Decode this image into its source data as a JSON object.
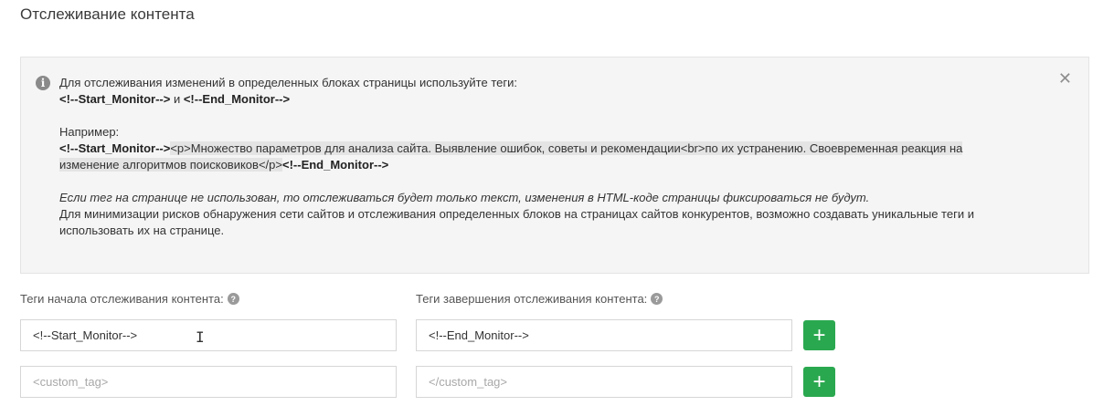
{
  "page": {
    "title": "Отслеживание контента"
  },
  "info": {
    "line1": "Для отслеживания изменений в определенных блоках страницы используйте теги:",
    "start_tag": "<!--Start_Monitor-->",
    "and_word": " и ",
    "end_tag": "<!--End_Monitor-->",
    "example_label": "Например:",
    "example_start_tag": "<!--Start_Monitor-->",
    "example_code": "<p>Множество параметров для анализа сайта. Выявление ошибок, советы и рекомендации<br>по их устранению. Своевременная реакция на изменение алгоритмов поисковиков</p>",
    "example_end_tag": "<!--End_Monitor-->",
    "note_italic": "Если тег на странице не использован, то отслеживаться будет только текст, изменения в HTML-коде страницы фиксироваться не будут.",
    "note_plain": "Для минимизации рисков обнаружения сети сайтов и отслеживания определенных блоков на страницах сайтов конкурентов, возможно создавать уникальные теги и использовать их на странице."
  },
  "form": {
    "start_label": "Теги начала отслеживания контента:",
    "end_label": "Теги завершения отслеживания контента:",
    "help_glyph": "?",
    "add_glyph": "+",
    "rows": [
      {
        "start_value": "<!--Start_Monitor-->",
        "start_placeholder": "",
        "end_value": "<!--End_Monitor-->",
        "end_placeholder": ""
      },
      {
        "start_value": "",
        "start_placeholder": "<custom_tag>",
        "end_value": "",
        "end_placeholder": "</custom_tag>"
      }
    ]
  },
  "colors": {
    "add_button": "#2aa84f",
    "info_background": "#f5f5f5"
  },
  "icons": {
    "info": "info-icon",
    "close": "close-icon",
    "help": "question-circle-icon",
    "add": "plus-icon",
    "cursor": "text-cursor-icon"
  }
}
